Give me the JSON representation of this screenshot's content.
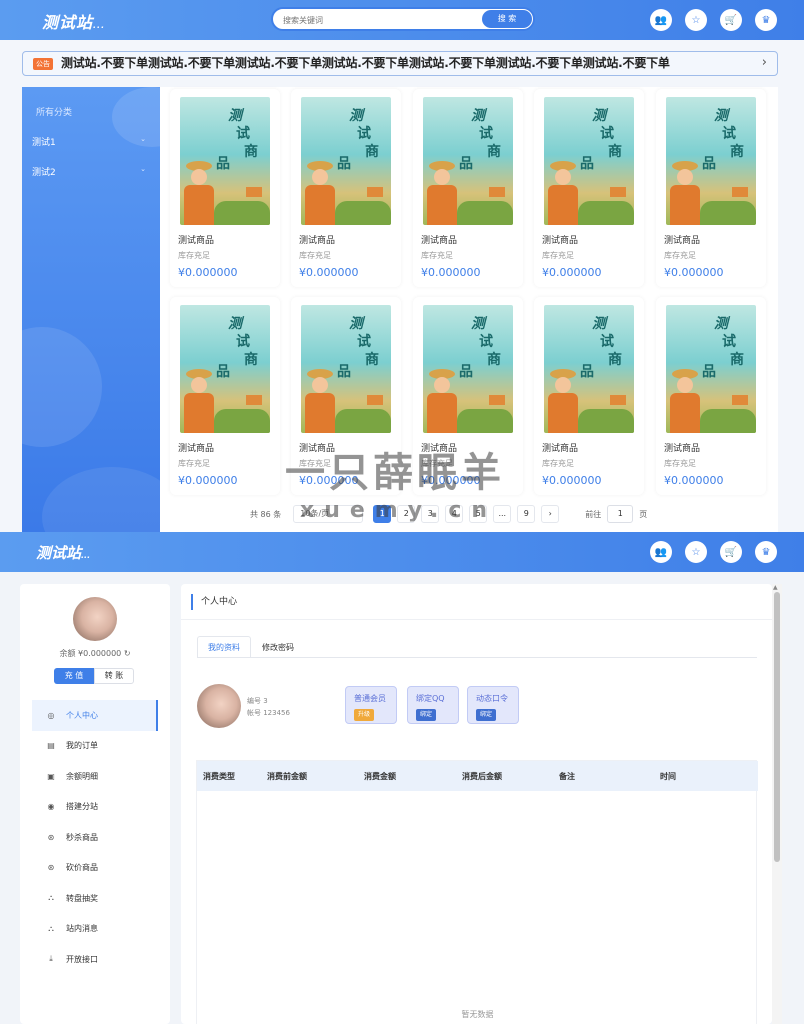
{
  "site": {
    "logo": "测试站",
    "logo_suffix": "..."
  },
  "search": {
    "placeholder": "搜索关键词",
    "button": "搜 索"
  },
  "header_icons": [
    {
      "name": "user-group-icon",
      "glyph": "👥"
    },
    {
      "name": "star-icon",
      "glyph": "☆"
    },
    {
      "name": "cart-icon",
      "glyph": "🛒"
    },
    {
      "name": "crown-icon",
      "glyph": "♛"
    }
  ],
  "notice": {
    "tag": "公告",
    "text": "测试站.不要下单测试站.不要下单测试站.不要下单测试站.不要下单测试站.不要下单测试站.不要下单测试站.不要下单",
    "arrow": "›"
  },
  "categories": {
    "title": "所有分类",
    "items": [
      {
        "label": "测试1",
        "chev": "⌄"
      },
      {
        "label": "测试2",
        "chev": "⌄"
      }
    ]
  },
  "goods": [
    {
      "name": "测试商品",
      "stock": "库存充足",
      "price": "¥0.000000"
    },
    {
      "name": "测试商品",
      "stock": "库存充足",
      "price": "¥0.000000"
    },
    {
      "name": "测试商品",
      "stock": "库存充足",
      "price": "¥0.000000"
    },
    {
      "name": "测试商品",
      "stock": "库存充足",
      "price": "¥0.000000"
    },
    {
      "name": "测试商品",
      "stock": "库存充足",
      "price": "¥0.000000"
    },
    {
      "name": "测试商品",
      "stock": "库存充足",
      "price": "¥0.000000"
    },
    {
      "name": "测试商品",
      "stock": "库存充足",
      "price": "¥0.000000"
    },
    {
      "name": "测试商品",
      "stock": "库存充足",
      "price": "¥0.000000"
    },
    {
      "name": "测试商品",
      "stock": "库存充足",
      "price": "¥0.000000"
    },
    {
      "name": "测试商品",
      "stock": "库存充足",
      "price": "¥0.000000"
    }
  ],
  "goods_image_text": [
    "测",
    "试",
    "商",
    "品"
  ],
  "pagination": {
    "total": "共 86 条",
    "page_size": "10条/页",
    "pages": [
      "1",
      "2",
      "3",
      "4",
      "5",
      "...",
      "9"
    ],
    "current": "1",
    "next": "›",
    "goto_label": "前往",
    "goto_value": "1",
    "goto_suffix": "页"
  },
  "watermark": {
    "line1": "一只薛眠羊",
    "line2": "xuemy.cn"
  },
  "user": {
    "balance": "余额 ¥0.000000",
    "refresh_icon": "↻",
    "recharge": "充 值",
    "transfer": "转 账",
    "id_line": "编号 3",
    "account_line": "帐号 123456"
  },
  "side_menu": [
    {
      "label": "个人中心",
      "icon": "◎",
      "icon_name": "user-circle-icon",
      "active": true
    },
    {
      "label": "我的订单",
      "icon": "▤",
      "icon_name": "order-icon",
      "active": false
    },
    {
      "label": "余额明细",
      "icon": "▣",
      "icon_name": "wallet-icon",
      "active": false
    },
    {
      "label": "搭建分站",
      "icon": "◉",
      "icon_name": "substation-icon",
      "active": false
    },
    {
      "label": "秒杀商品",
      "icon": "⊛",
      "icon_name": "flash-sale-icon",
      "active": false
    },
    {
      "label": "砍价商品",
      "icon": "⊛",
      "icon_name": "bargain-icon",
      "active": false
    },
    {
      "label": "转盘抽奖",
      "icon": "⛬",
      "icon_name": "lottery-icon",
      "active": false
    },
    {
      "label": "站内消息",
      "icon": "⛬",
      "icon_name": "message-icon",
      "active": false
    },
    {
      "label": "开放接口",
      "icon": "⤓",
      "icon_name": "api-icon",
      "active": false
    }
  ],
  "profile": {
    "title": "个人中心",
    "tabs": [
      "我的资料",
      "修改密码"
    ],
    "badges": [
      {
        "title": "普通会员",
        "button": "升级",
        "color": "#f0a93b"
      },
      {
        "title": "绑定QQ",
        "button": "绑定",
        "color": "#3f6fd0"
      },
      {
        "title": "动态口令",
        "button": "绑定",
        "color": "#3f6fd0"
      }
    ],
    "table_headers": [
      "消费类型",
      "消费前金额",
      "消费金额",
      "消费后金额",
      "备注",
      "时间"
    ],
    "empty_text": "暂无数据"
  },
  "colors": {
    "primary": "#3f7fe8",
    "accent_orange": "#f37335",
    "price": "#3f7fe8"
  }
}
